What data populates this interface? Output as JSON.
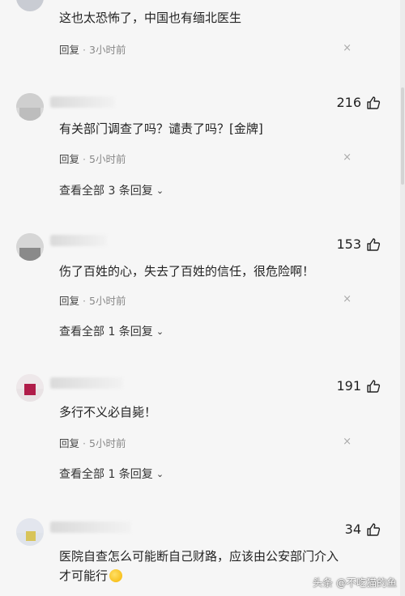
{
  "comments": [
    {
      "text": "这也太恐怖了，中国也有缅北医生",
      "reply_label": "回复",
      "time": "3小时前",
      "close": "×"
    },
    {
      "likes": "216",
      "text": "有关部门调查了吗？谴责了吗？[金牌]",
      "reply_label": "回复",
      "time": "5小时前",
      "close": "×",
      "view_replies": "查看全部 3 条回复"
    },
    {
      "likes": "153",
      "text": "伤了百姓的心，失去了百姓的信任，很危险啊！",
      "reply_label": "回复",
      "time": "5小时前",
      "close": "×",
      "view_replies": "查看全部 1 条回复"
    },
    {
      "likes": "191",
      "text": "多行不义必自毙！",
      "reply_label": "回复",
      "time": "5小时前",
      "close": "×",
      "view_replies": "查看全部 1 条回复"
    },
    {
      "likes": "34",
      "text_line1": "医院自查怎么可能断自己财路，应该由公安部门介入",
      "text_line2": "才可能行"
    }
  ],
  "watermark": "头条 @不吃猫的鱼",
  "icons": {
    "like": "thumbs-up-icon",
    "close": "close-icon",
    "chevron": "chevron-down-icon",
    "emoji": "laughing-emoji-icon"
  }
}
